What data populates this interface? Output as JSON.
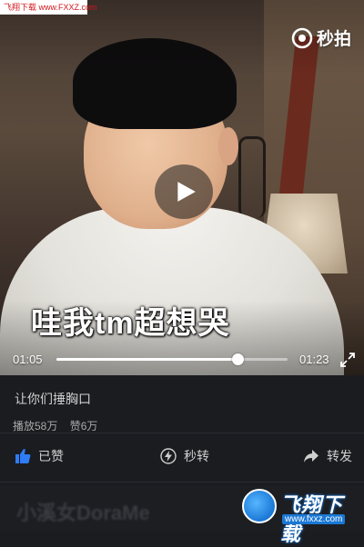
{
  "site_badge": "飞翔下载 www.FXXZ.com",
  "player": {
    "logo_text": "秒拍",
    "subtitle": "哇我tm超想哭",
    "time_current": "01:05",
    "time_total": "01:23",
    "progress": 0.783
  },
  "video": {
    "title": "让你们捶胸口",
    "plays": "播放58万",
    "likes": "赞6万"
  },
  "actions": {
    "like": "已赞",
    "repost": "秒转",
    "share": "转发"
  },
  "next_item": {
    "text": "小溪女DoraMe"
  },
  "watermark": {
    "title": "飞翔下载",
    "url": "www.fxxz.com"
  },
  "colors": {
    "background": "#1b1c20",
    "like_accent": "#2f7cf6",
    "badge_red": "#d4161c"
  },
  "icons": {
    "like": "thumbs-up-icon",
    "repost": "lightning-icon",
    "share": "share-arrow-icon",
    "fullscreen": "expand-icon",
    "play": "play-icon"
  }
}
